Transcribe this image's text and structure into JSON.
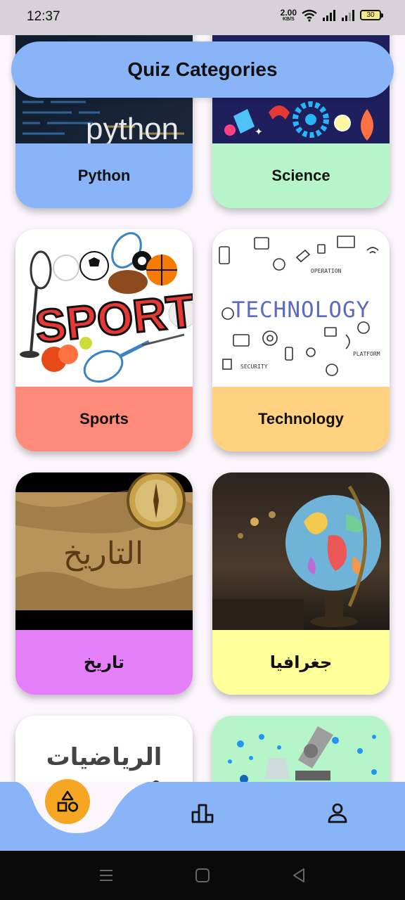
{
  "status_bar": {
    "time": "12:37",
    "net_speed_value": "2.00",
    "net_speed_unit": "KB/S",
    "battery": "30"
  },
  "header": {
    "title": "Quiz Categories"
  },
  "categories": [
    {
      "label": "Python",
      "color": "#8ab4f8",
      "image_text": "python"
    },
    {
      "label": "Science",
      "color": "#b6f5c9"
    },
    {
      "label": "Sports",
      "color": "#ff8a7a",
      "image_text": "SPORT"
    },
    {
      "label": "Technology",
      "color": "#ffd180",
      "image_text": "TECHNOLOGY"
    },
    {
      "label": "تاريخ",
      "color": "#e57ff9",
      "image_text": "التاريخ"
    },
    {
      "label": "جغرافيا",
      "color": "#ffff99"
    },
    {
      "label": "",
      "color": "#ffffff",
      "image_text": "الرياضيات"
    },
    {
      "label": "",
      "color": "#b6f5c9"
    }
  ],
  "bottom_nav": {
    "background": "#8ab4f8",
    "active_color": "#f5a623",
    "items": [
      {
        "icon": "categories-icon",
        "active": true
      },
      {
        "icon": "leaderboard-icon",
        "active": false
      },
      {
        "icon": "profile-icon",
        "active": false
      }
    ]
  },
  "system_nav": {
    "icons": [
      "menu-icon",
      "home-icon",
      "back-icon"
    ]
  }
}
